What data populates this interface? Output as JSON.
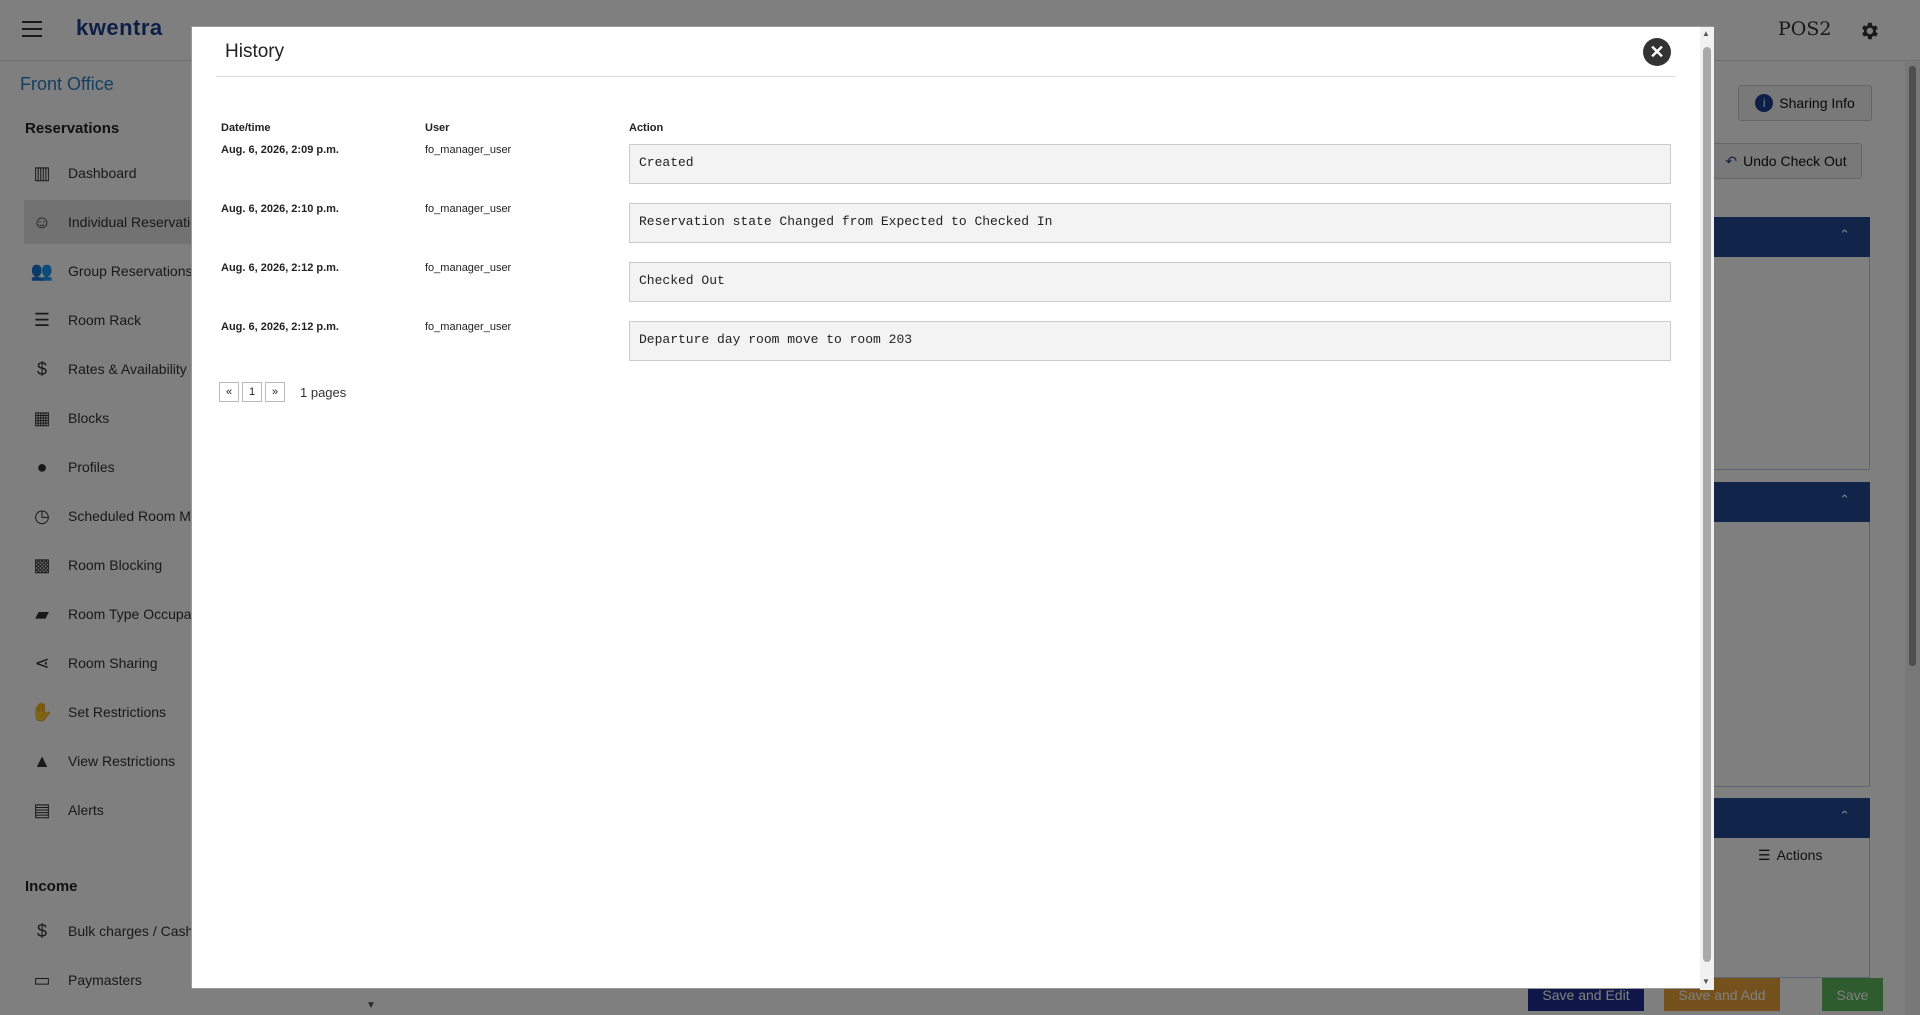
{
  "app": {
    "logo": "kwentra",
    "station": "POS2"
  },
  "sidebar": {
    "title": "Front Office",
    "sections": {
      "reservations": "Reservations",
      "income": "Income"
    },
    "items": [
      {
        "label": "Dashboard",
        "icon": "bar-chart-icon"
      },
      {
        "label": "Individual Reservatio",
        "icon": "person-icon"
      },
      {
        "label": "Group Reservations",
        "icon": "group-icon"
      },
      {
        "label": "Room Rack",
        "icon": "list-icon"
      },
      {
        "label": "Rates & Availability",
        "icon": "dollar-circle-icon"
      },
      {
        "label": "Blocks",
        "icon": "dashboard-icon"
      },
      {
        "label": "Profiles",
        "icon": "account-circle-icon"
      },
      {
        "label": "Scheduled Room Mo",
        "icon": "clock-icon"
      },
      {
        "label": "Room Blocking",
        "icon": "grid-icon"
      },
      {
        "label": "Room Type Occupan",
        "icon": "label-icon"
      },
      {
        "label": "Room Sharing",
        "icon": "share-icon"
      },
      {
        "label": "Set Restrictions",
        "icon": "hand-icon"
      },
      {
        "label": "View Restrictions",
        "icon": "warning-icon"
      },
      {
        "label": "Alerts",
        "icon": "note-icon"
      },
      {
        "label": "Bulk charges / Cashi",
        "icon": "dollar-icon"
      },
      {
        "label": "Paymasters",
        "icon": "card-icon"
      }
    ]
  },
  "right_panel": {
    "sharing_info": "Sharing Info",
    "undo_check_out": "Undo Check Out",
    "actions": "Actions"
  },
  "footer_buttons": {
    "save_and_edit": "Save and Edit",
    "save_and_add": "Save and Add",
    "save": "Save"
  },
  "modal": {
    "title": "History",
    "columns": {
      "datetime": "Date/time",
      "user": "User",
      "action": "Action"
    },
    "rows": [
      {
        "datetime": "Aug. 6, 2026, 2:09 p.m.",
        "user": "fo_manager_user",
        "action": "Created"
      },
      {
        "datetime": "Aug. 6, 2026, 2:10 p.m.",
        "user": "fo_manager_user",
        "action": "Reservation state Changed from Expected to Checked In"
      },
      {
        "datetime": "Aug. 6, 2026, 2:12 p.m.",
        "user": "fo_manager_user",
        "action": "Checked Out"
      },
      {
        "datetime": "Aug. 6, 2026, 2:12 p.m.",
        "user": "fo_manager_user",
        "action": "Departure day room move to room 203"
      }
    ],
    "pagination": {
      "prev": "«",
      "current": "1",
      "next": "»",
      "summary": "1 pages"
    }
  }
}
